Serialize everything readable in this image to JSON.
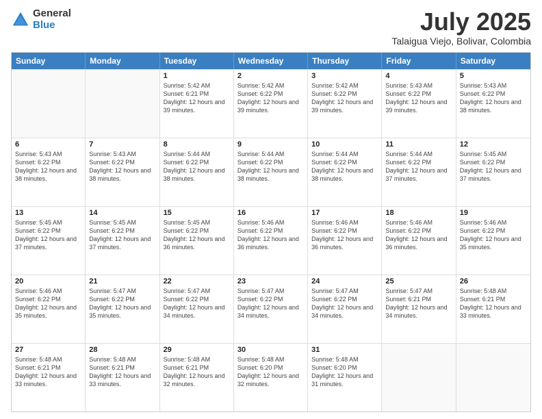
{
  "logo": {
    "general": "General",
    "blue": "Blue"
  },
  "title": "July 2025",
  "subtitle": "Talaigua Viejo, Bolivar, Colombia",
  "days_of_week": [
    "Sunday",
    "Monday",
    "Tuesday",
    "Wednesday",
    "Thursday",
    "Friday",
    "Saturday"
  ],
  "weeks": [
    [
      {
        "day": "",
        "empty": true
      },
      {
        "day": "",
        "empty": true
      },
      {
        "day": "1",
        "sunrise": "Sunrise: 5:42 AM",
        "sunset": "Sunset: 6:21 PM",
        "daylight": "Daylight: 12 hours and 39 minutes."
      },
      {
        "day": "2",
        "sunrise": "Sunrise: 5:42 AM",
        "sunset": "Sunset: 6:22 PM",
        "daylight": "Daylight: 12 hours and 39 minutes."
      },
      {
        "day": "3",
        "sunrise": "Sunrise: 5:42 AM",
        "sunset": "Sunset: 6:22 PM",
        "daylight": "Daylight: 12 hours and 39 minutes."
      },
      {
        "day": "4",
        "sunrise": "Sunrise: 5:43 AM",
        "sunset": "Sunset: 6:22 PM",
        "daylight": "Daylight: 12 hours and 39 minutes."
      },
      {
        "day": "5",
        "sunrise": "Sunrise: 5:43 AM",
        "sunset": "Sunset: 6:22 PM",
        "daylight": "Daylight: 12 hours and 38 minutes."
      }
    ],
    [
      {
        "day": "6",
        "sunrise": "Sunrise: 5:43 AM",
        "sunset": "Sunset: 6:22 PM",
        "daylight": "Daylight: 12 hours and 38 minutes."
      },
      {
        "day": "7",
        "sunrise": "Sunrise: 5:43 AM",
        "sunset": "Sunset: 6:22 PM",
        "daylight": "Daylight: 12 hours and 38 minutes."
      },
      {
        "day": "8",
        "sunrise": "Sunrise: 5:44 AM",
        "sunset": "Sunset: 6:22 PM",
        "daylight": "Daylight: 12 hours and 38 minutes."
      },
      {
        "day": "9",
        "sunrise": "Sunrise: 5:44 AM",
        "sunset": "Sunset: 6:22 PM",
        "daylight": "Daylight: 12 hours and 38 minutes."
      },
      {
        "day": "10",
        "sunrise": "Sunrise: 5:44 AM",
        "sunset": "Sunset: 6:22 PM",
        "daylight": "Daylight: 12 hours and 38 minutes."
      },
      {
        "day": "11",
        "sunrise": "Sunrise: 5:44 AM",
        "sunset": "Sunset: 6:22 PM",
        "daylight": "Daylight: 12 hours and 37 minutes."
      },
      {
        "day": "12",
        "sunrise": "Sunrise: 5:45 AM",
        "sunset": "Sunset: 6:22 PM",
        "daylight": "Daylight: 12 hours and 37 minutes."
      }
    ],
    [
      {
        "day": "13",
        "sunrise": "Sunrise: 5:45 AM",
        "sunset": "Sunset: 6:22 PM",
        "daylight": "Daylight: 12 hours and 37 minutes."
      },
      {
        "day": "14",
        "sunrise": "Sunrise: 5:45 AM",
        "sunset": "Sunset: 6:22 PM",
        "daylight": "Daylight: 12 hours and 37 minutes."
      },
      {
        "day": "15",
        "sunrise": "Sunrise: 5:45 AM",
        "sunset": "Sunset: 6:22 PM",
        "daylight": "Daylight: 12 hours and 36 minutes."
      },
      {
        "day": "16",
        "sunrise": "Sunrise: 5:46 AM",
        "sunset": "Sunset: 6:22 PM",
        "daylight": "Daylight: 12 hours and 36 minutes."
      },
      {
        "day": "17",
        "sunrise": "Sunrise: 5:46 AM",
        "sunset": "Sunset: 6:22 PM",
        "daylight": "Daylight: 12 hours and 36 minutes."
      },
      {
        "day": "18",
        "sunrise": "Sunrise: 5:46 AM",
        "sunset": "Sunset: 6:22 PM",
        "daylight": "Daylight: 12 hours and 36 minutes."
      },
      {
        "day": "19",
        "sunrise": "Sunrise: 5:46 AM",
        "sunset": "Sunset: 6:22 PM",
        "daylight": "Daylight: 12 hours and 35 minutes."
      }
    ],
    [
      {
        "day": "20",
        "sunrise": "Sunrise: 5:46 AM",
        "sunset": "Sunset: 6:22 PM",
        "daylight": "Daylight: 12 hours and 35 minutes."
      },
      {
        "day": "21",
        "sunrise": "Sunrise: 5:47 AM",
        "sunset": "Sunset: 6:22 PM",
        "daylight": "Daylight: 12 hours and 35 minutes."
      },
      {
        "day": "22",
        "sunrise": "Sunrise: 5:47 AM",
        "sunset": "Sunset: 6:22 PM",
        "daylight": "Daylight: 12 hours and 34 minutes."
      },
      {
        "day": "23",
        "sunrise": "Sunrise: 5:47 AM",
        "sunset": "Sunset: 6:22 PM",
        "daylight": "Daylight: 12 hours and 34 minutes."
      },
      {
        "day": "24",
        "sunrise": "Sunrise: 5:47 AM",
        "sunset": "Sunset: 6:22 PM",
        "daylight": "Daylight: 12 hours and 34 minutes."
      },
      {
        "day": "25",
        "sunrise": "Sunrise: 5:47 AM",
        "sunset": "Sunset: 6:21 PM",
        "daylight": "Daylight: 12 hours and 34 minutes."
      },
      {
        "day": "26",
        "sunrise": "Sunrise: 5:48 AM",
        "sunset": "Sunset: 6:21 PM",
        "daylight": "Daylight: 12 hours and 33 minutes."
      }
    ],
    [
      {
        "day": "27",
        "sunrise": "Sunrise: 5:48 AM",
        "sunset": "Sunset: 6:21 PM",
        "daylight": "Daylight: 12 hours and 33 minutes."
      },
      {
        "day": "28",
        "sunrise": "Sunrise: 5:48 AM",
        "sunset": "Sunset: 6:21 PM",
        "daylight": "Daylight: 12 hours and 33 minutes."
      },
      {
        "day": "29",
        "sunrise": "Sunrise: 5:48 AM",
        "sunset": "Sunset: 6:21 PM",
        "daylight": "Daylight: 12 hours and 32 minutes."
      },
      {
        "day": "30",
        "sunrise": "Sunrise: 5:48 AM",
        "sunset": "Sunset: 6:20 PM",
        "daylight": "Daylight: 12 hours and 32 minutes."
      },
      {
        "day": "31",
        "sunrise": "Sunrise: 5:48 AM",
        "sunset": "Sunset: 6:20 PM",
        "daylight": "Daylight: 12 hours and 31 minutes."
      },
      {
        "day": "",
        "empty": true
      },
      {
        "day": "",
        "empty": true
      }
    ]
  ]
}
